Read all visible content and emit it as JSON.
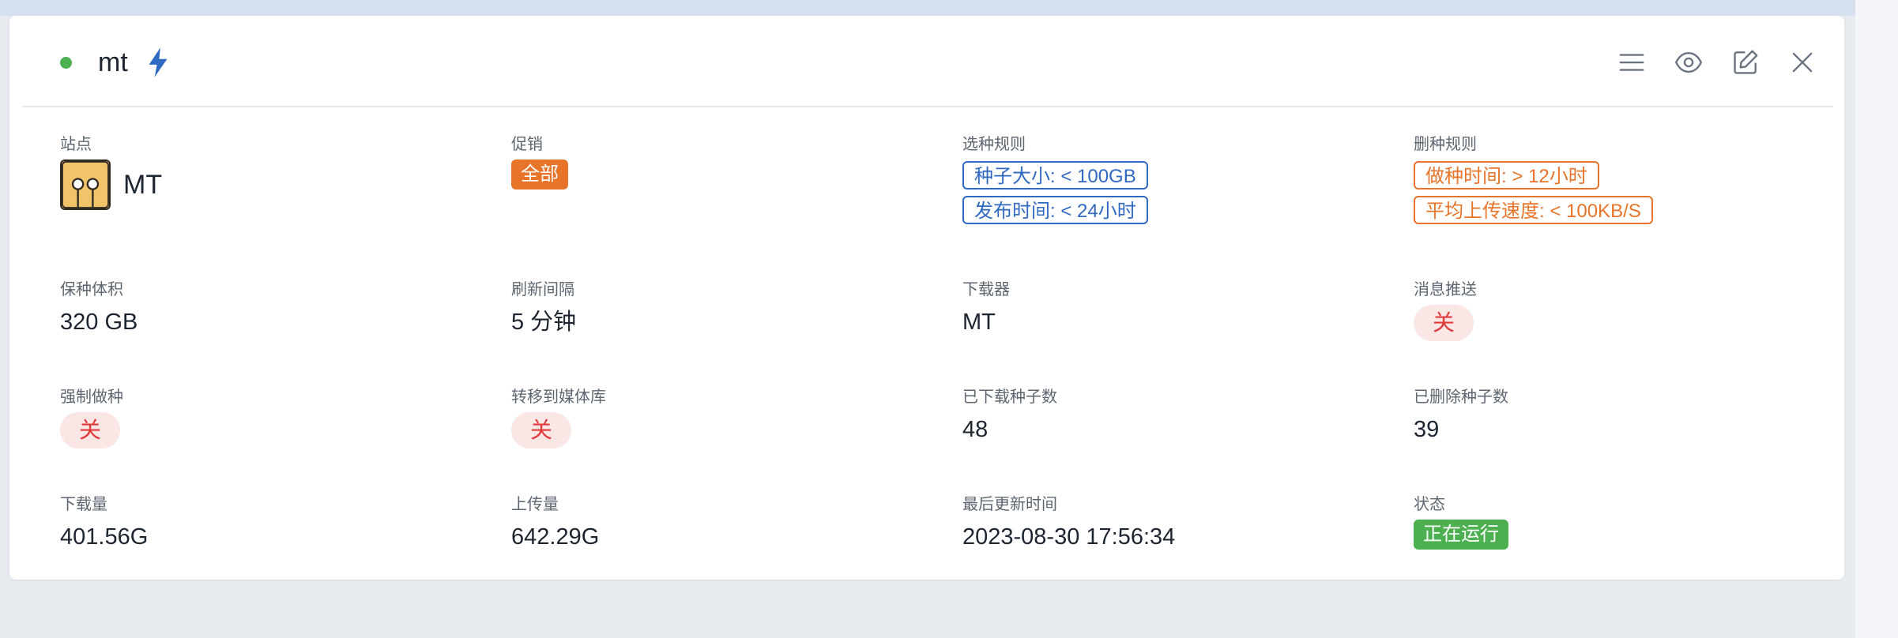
{
  "card": {
    "title": "mt",
    "status_color": "#4caf50",
    "icons": [
      "bolt-icon",
      "menu-icon",
      "eye-icon",
      "edit-icon",
      "close-icon"
    ]
  },
  "fields": {
    "site": {
      "label": "站点",
      "value": "MT"
    },
    "promotion": {
      "label": "促销",
      "value": "全部"
    },
    "select_rules": {
      "label": "选种规则",
      "tags": [
        "种子大小: < 100GB",
        "发布时间: < 24小时"
      ]
    },
    "delete_rules": {
      "label": "删种规则",
      "tags": [
        "做种时间: > 12小时",
        "平均上传速度: < 100KB/S"
      ]
    },
    "seed_volume": {
      "label": "保种体积",
      "value": "320 GB"
    },
    "refresh_interval": {
      "label": "刷新间隔",
      "value": "5 分钟"
    },
    "downloader": {
      "label": "下载器",
      "value": "MT"
    },
    "notify": {
      "label": "消息推送",
      "value": "关"
    },
    "force_seed": {
      "label": "强制做种",
      "value": "关"
    },
    "transfer_media": {
      "label": "转移到媒体库",
      "value": "关"
    },
    "downloaded_count": {
      "label": "已下载种子数",
      "value": "48"
    },
    "deleted_count": {
      "label": "已删除种子数",
      "value": "39"
    },
    "download_amount": {
      "label": "下载量",
      "value": "401.56G"
    },
    "upload_amount": {
      "label": "上传量",
      "value": "642.29G"
    },
    "last_update": {
      "label": "最后更新时间",
      "value": "2023-08-30 17:56:34"
    },
    "state": {
      "label": "状态",
      "value": "正在运行"
    }
  },
  "colors": {
    "accent_blue": "#2f69c2",
    "accent_orange": "#e8742a",
    "status_green": "#4caf50",
    "off_red": "#e03a3a"
  }
}
